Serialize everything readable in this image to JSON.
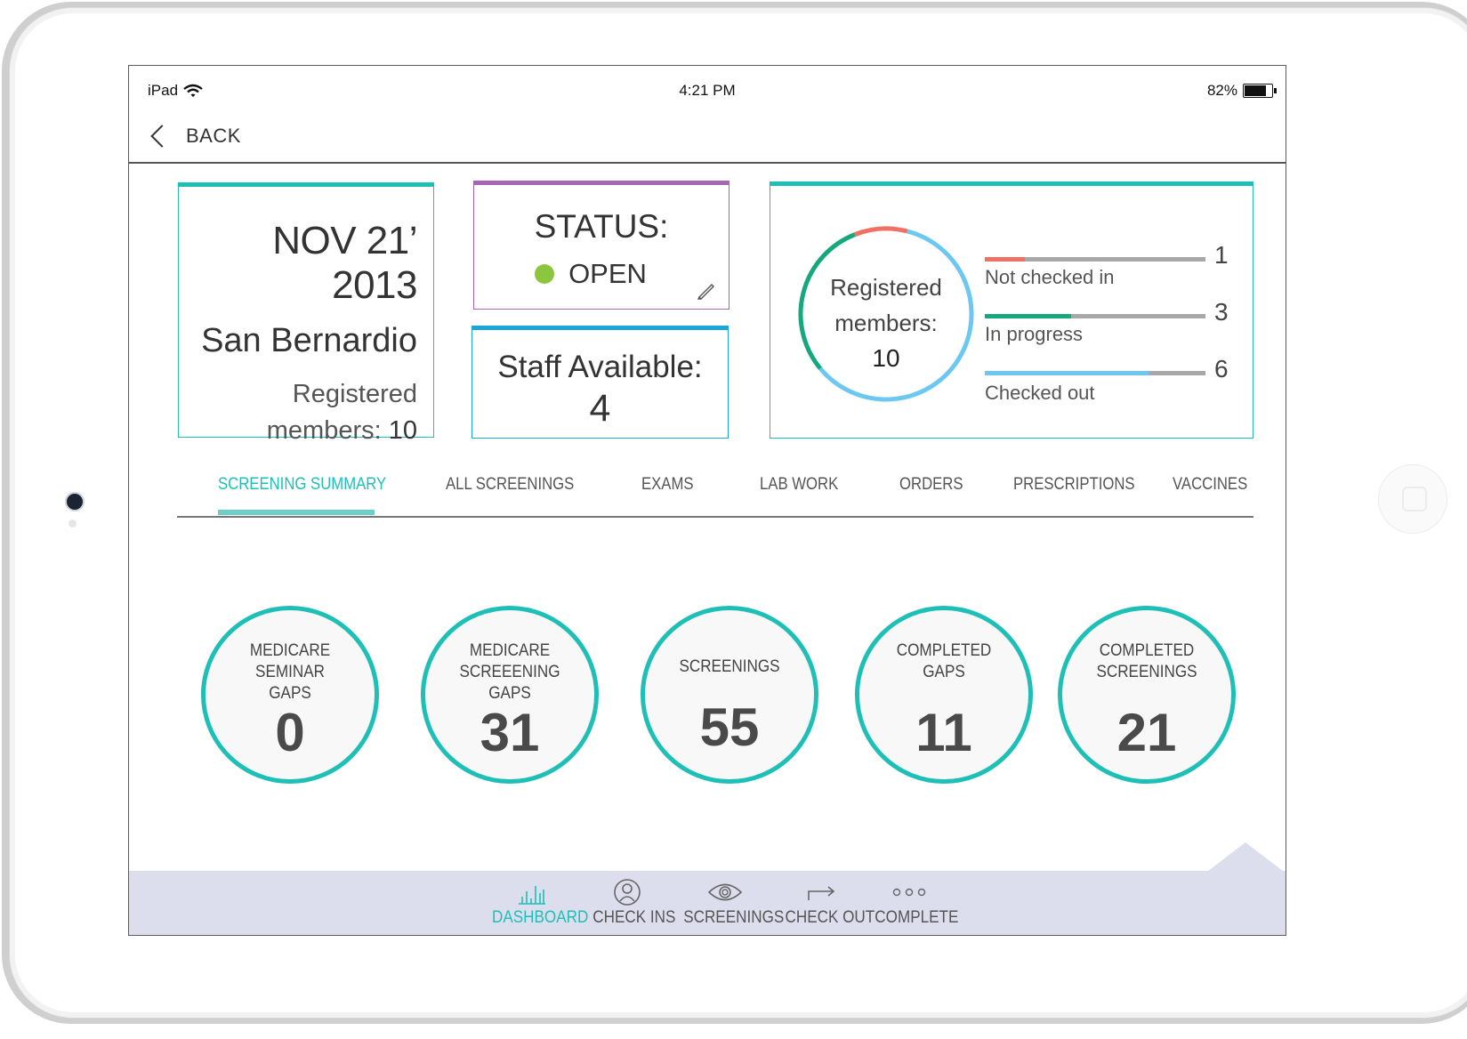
{
  "status_bar": {
    "device": "iPad",
    "time": "4:21 PM",
    "battery": "82%",
    "battery_level": 0.82
  },
  "nav": {
    "back_label": "BACK"
  },
  "event": {
    "date": "NOV 21’ 2013",
    "location": "San Bernardio",
    "registered_label": "Registered",
    "members_label": "members:",
    "registered_count": "10"
  },
  "status": {
    "title": "STATUS:",
    "value": "OPEN",
    "indicator_color": "#8cc63f"
  },
  "staff": {
    "label": "Staff Available:",
    "count": "4"
  },
  "members_chart": {
    "center_line1": "Registered",
    "center_line2": "members:",
    "center_count": "10",
    "rows": [
      {
        "label": "Not checked in",
        "count": "1",
        "value": 1,
        "color": "#f07064"
      },
      {
        "label": "In progress",
        "count": "3",
        "value": 3,
        "color": "#15a77e"
      },
      {
        "label": "Checked out",
        "count": "6",
        "value": 6,
        "color": "#6cc8f0"
      }
    ],
    "total": 10
  },
  "tabs": [
    {
      "label": "SCREENING SUMMARY",
      "active": true
    },
    {
      "label": "ALL SCREENINGS",
      "active": false
    },
    {
      "label": "EXAMS",
      "active": false
    },
    {
      "label": "LAB WORK",
      "active": false
    },
    {
      "label": "ORDERS",
      "active": false
    },
    {
      "label": "PRESCRIPTIONS",
      "active": false
    },
    {
      "label": "VACCINES",
      "active": false
    }
  ],
  "stats": [
    {
      "lines": [
        "MEDICARE",
        "SEMINAR",
        "GAPS"
      ],
      "value": "0"
    },
    {
      "lines": [
        "MEDICARE",
        "SCREEENING",
        "GAPS"
      ],
      "value": "31"
    },
    {
      "lines": [
        "SCREENINGS"
      ],
      "value": "55"
    },
    {
      "lines": [
        "COMPLETED",
        "GAPS"
      ],
      "value": "11"
    },
    {
      "lines": [
        "COMPLETED",
        "SCREENINGS"
      ],
      "value": "21"
    }
  ],
  "bottom_tabs": [
    {
      "label": "DASHBOARD",
      "icon": "bar-chart-icon",
      "active": true
    },
    {
      "label": "CHECK INS",
      "icon": "user-circle-icon",
      "active": false
    },
    {
      "label": "SCREENINGS",
      "icon": "eye-icon",
      "active": false
    },
    {
      "label": "CHECK OUT",
      "icon": "arrow-right-icon",
      "active": false
    },
    {
      "label": "COMPLETE",
      "icon": "dots-icon",
      "active": false
    }
  ],
  "colors": {
    "teal": "#1ebfb6",
    "purple": "#a566b3",
    "blue": "#1ba6d8"
  }
}
